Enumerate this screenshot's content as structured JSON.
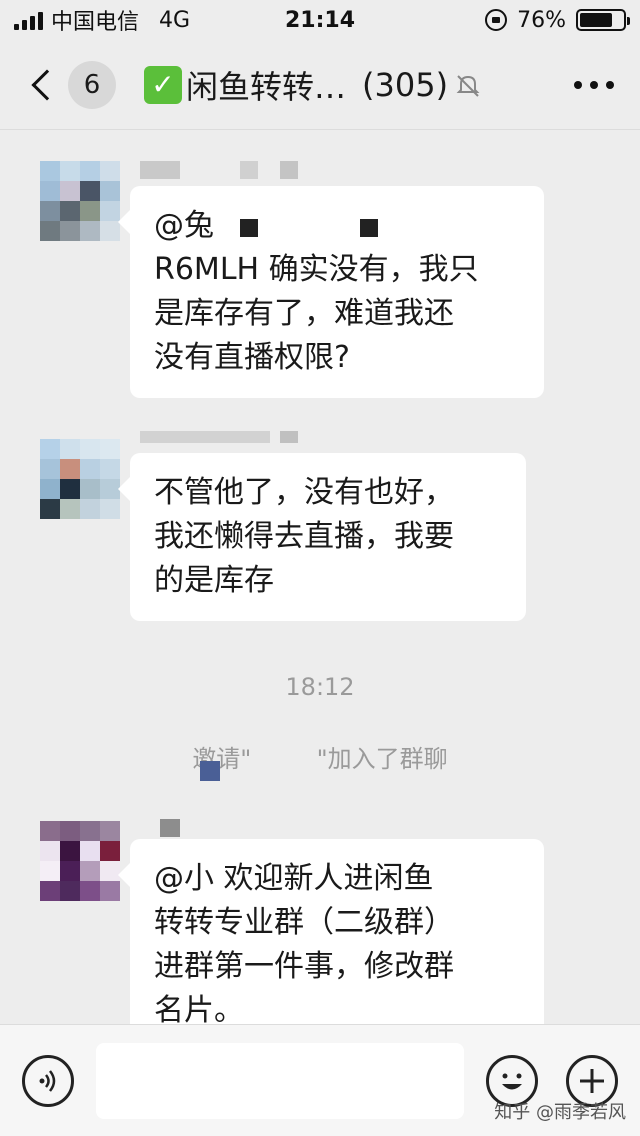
{
  "status_bar": {
    "carrier": "中国电信",
    "network": "4G",
    "time": "21:14",
    "battery": "76%",
    "battery_level": 0.76
  },
  "nav": {
    "unread_count": "6",
    "title": "闲鱼转转…",
    "member_count": "(305)"
  },
  "messages": [
    {
      "text": "@兔\nR6MLH 确实没有，我只\n是库存有了，难道我还\n没有直播权限?"
    },
    {
      "text": "不管他了，没有也好，\n我还懒得去直播，我要\n的是库存"
    },
    {
      "text": "@小 欢迎新人进闲鱼\n转转专业群（二级群）\n进群第一件事，修改群\n名片。"
    }
  ],
  "timestamp": "18:12",
  "system_message": {
    "part1": "邀请\"",
    "part2": "\"加入了群聊"
  },
  "watermark": "知乎 @雨季若风",
  "colors": {
    "background": "#ededed",
    "bubble": "#ffffff",
    "accent_check": "#5bbf3a"
  }
}
